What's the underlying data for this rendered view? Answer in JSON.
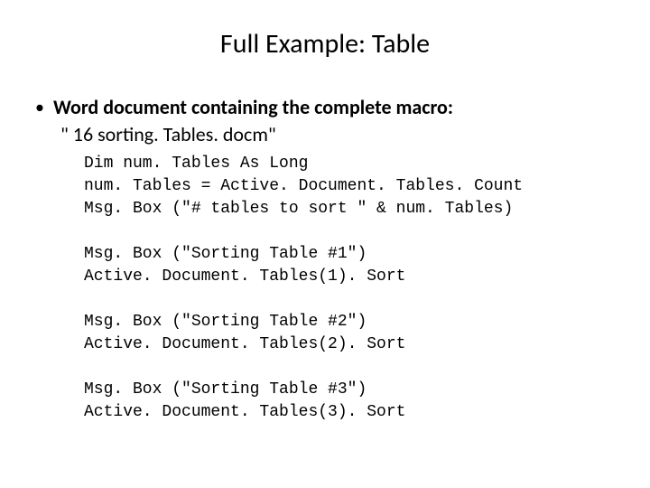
{
  "title": "Full Example: Table",
  "bullet": {
    "marker": "•",
    "heading": "Word document containing the complete macro:",
    "filename": "\" 16 sorting. Tables. docm\""
  },
  "code": {
    "block1": [
      "Dim num. Tables As Long",
      "num. Tables = Active. Document. Tables. Count",
      "Msg. Box (\"# tables to sort \" & num. Tables)"
    ],
    "block2": [
      "Msg. Box (\"Sorting Table #1\")",
      "Active. Document. Tables(1). Sort"
    ],
    "block3": [
      "Msg. Box (\"Sorting Table #2\")",
      "Active. Document. Tables(2). Sort"
    ],
    "block4": [
      "Msg. Box (\"Sorting Table #3\")",
      "Active. Document. Tables(3). Sort"
    ]
  }
}
